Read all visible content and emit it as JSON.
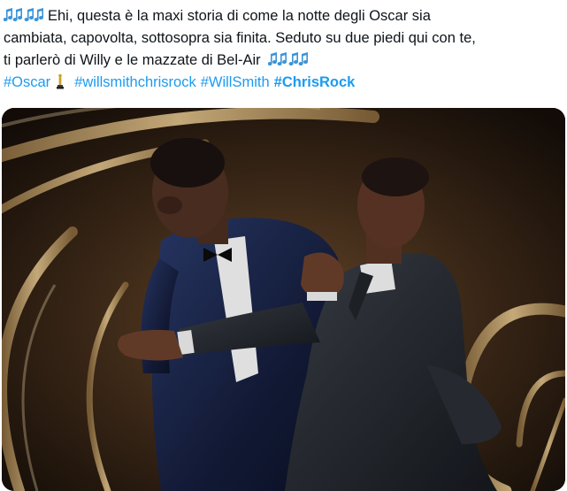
{
  "tweet": {
    "line1": "Ehi, questa è la maxi storia di come la notte degli Oscar sia",
    "line2": "cambiata, capovolta, sottosopra sia finita. Seduto su due piedi qui con te,",
    "line3": "ti parlerò di Willy e le mazzate di Bel-Air",
    "hashtags": [
      "#Oscar",
      "#willsmithchrisrock",
      "#WillSmith",
      "#ChrisRock"
    ],
    "icons": {
      "music_notes": "musical-notes-emoji",
      "oscar": "oscar-statuette-emoji"
    }
  },
  "colors": {
    "text": "#0f1419",
    "hashtag": "#1d9bf0",
    "note_emoji": "#3b94d9"
  }
}
